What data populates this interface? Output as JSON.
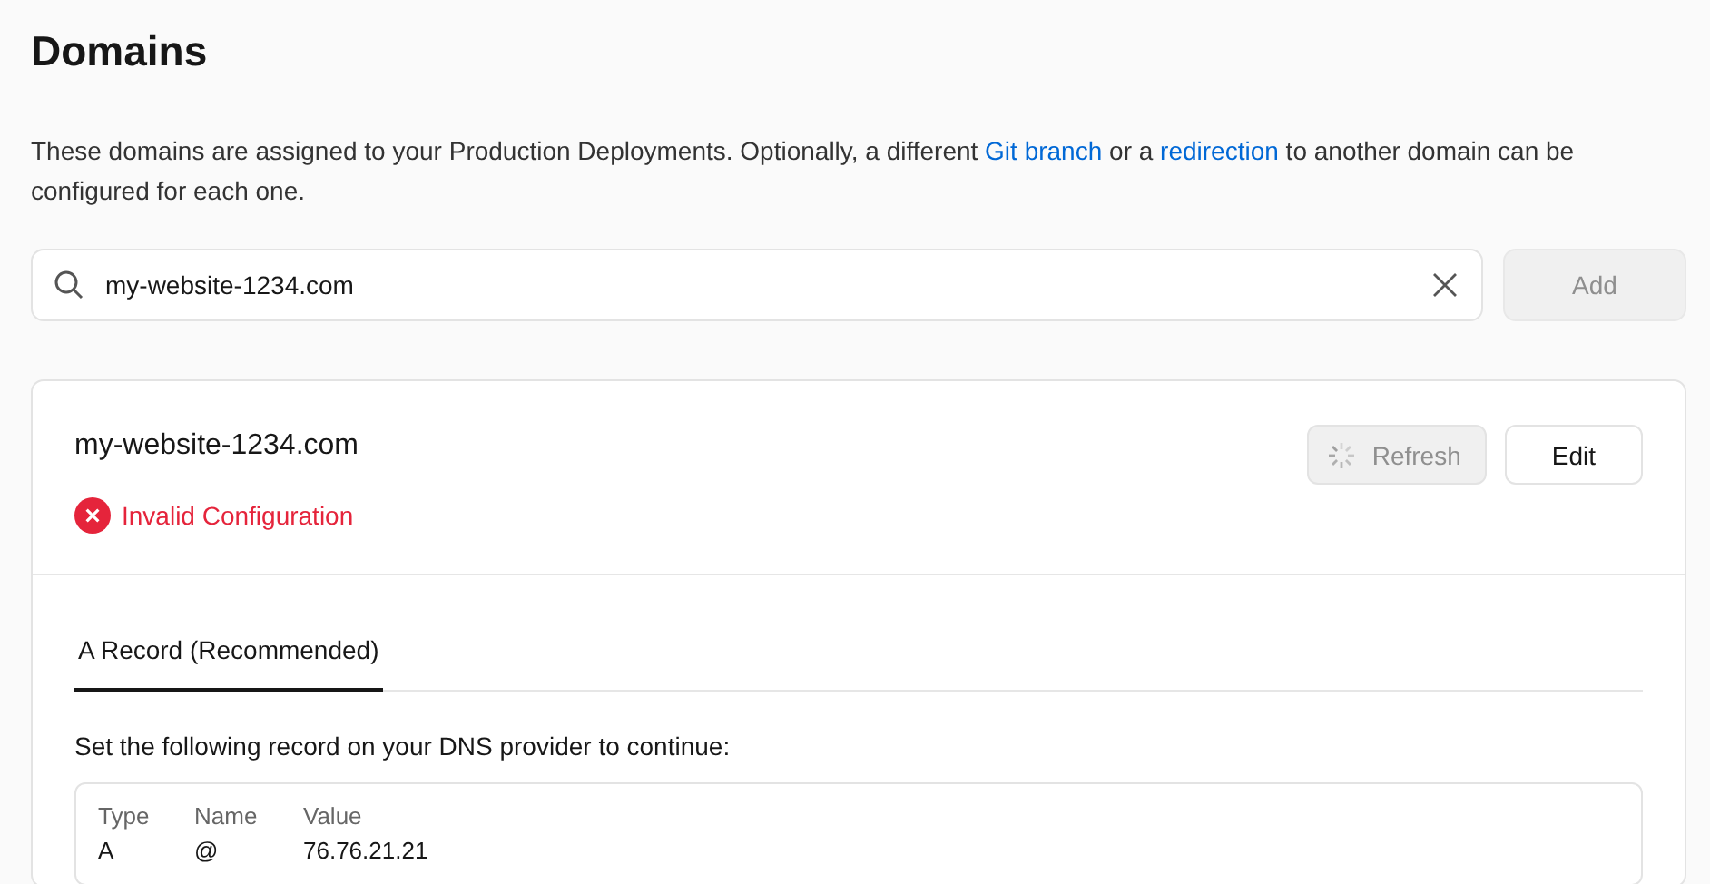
{
  "title": "Domains",
  "description": [
    {
      "kind": "text",
      "text": "These domains are assigned to your Production Deployments. Optionally, a different "
    },
    {
      "kind": "link",
      "text": "Git branch"
    },
    {
      "kind": "text",
      "text": " or a "
    },
    {
      "kind": "link",
      "text": "redirection"
    },
    {
      "kind": "text",
      "text": " to another domain can be configured for each one."
    }
  ],
  "search": {
    "value": "my-website-1234.com"
  },
  "add_button": {
    "label": "Add",
    "disabled": true
  },
  "domain_card": {
    "domain": "my-website-1234.com",
    "status": {
      "kind": "error",
      "label": "Invalid Configuration"
    },
    "refresh_button": {
      "label": "Refresh",
      "disabled": true,
      "loading": true
    },
    "edit_button": {
      "label": "Edit",
      "disabled": false
    },
    "tabs": [
      {
        "label": "A Record (Recommended)",
        "selected": true
      }
    ],
    "instruction": "Set the following record on your DNS provider to continue:",
    "table": {
      "columns": [
        "Type",
        "Name",
        "Value"
      ],
      "rows": [
        [
          "A",
          "@",
          "76.76.21.21"
        ]
      ]
    }
  }
}
